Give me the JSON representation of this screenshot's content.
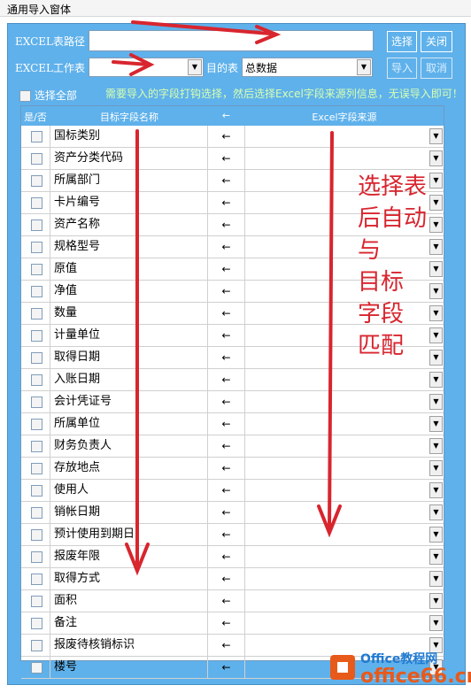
{
  "window": {
    "title": "通用导入窗体"
  },
  "form": {
    "path_label": "EXCEL表路径",
    "path_value": "",
    "sheet_label": "EXCEL工作表",
    "sheet_value": "",
    "target_label": "目的表",
    "target_value": "总数据",
    "select_btn": "选择",
    "close_btn": "关闭",
    "import_btn": "导入",
    "cancel_btn": "取消"
  },
  "select_all_label": "选择全部",
  "hint": "需要导入的字段打钩选择，然后选择Excel字段来源列信息，无误导入即可！",
  "table": {
    "headers": [
      "是/否",
      "目标字段名称",
      "←",
      "Excel字段来源"
    ],
    "rows": [
      {
        "field": "国标类别",
        "arrow": "←"
      },
      {
        "field": "资产分类代码",
        "arrow": "←"
      },
      {
        "field": "所属部门",
        "arrow": "←"
      },
      {
        "field": "卡片编号",
        "arrow": "←"
      },
      {
        "field": "资产名称",
        "arrow": "←"
      },
      {
        "field": "规格型号",
        "arrow": "←"
      },
      {
        "field": "原值",
        "arrow": "←"
      },
      {
        "field": "净值",
        "arrow": "←"
      },
      {
        "field": "数量",
        "arrow": "←"
      },
      {
        "field": "计量单位",
        "arrow": "←"
      },
      {
        "field": "取得日期",
        "arrow": "←"
      },
      {
        "field": "入账日期",
        "arrow": "←"
      },
      {
        "field": "会计凭证号",
        "arrow": "←"
      },
      {
        "field": "所属单位",
        "arrow": "←"
      },
      {
        "field": "财务负责人",
        "arrow": "←"
      },
      {
        "field": "存放地点",
        "arrow": "←"
      },
      {
        "field": "使用人",
        "arrow": "←"
      },
      {
        "field": "销帐日期",
        "arrow": "←"
      },
      {
        "field": "预计使用到期日",
        "arrow": "←"
      },
      {
        "field": "报废年限",
        "arrow": "←"
      },
      {
        "field": "取得方式",
        "arrow": "←"
      },
      {
        "field": "面积",
        "arrow": "←"
      },
      {
        "field": "备注",
        "arrow": "←"
      },
      {
        "field": "报废待核销标识",
        "arrow": "←"
      },
      {
        "field": "楼号",
        "arrow": "←"
      }
    ]
  },
  "annotation": "选择表\n后自动\n与\n目标\n字段\n匹配",
  "watermark": {
    "top": "Office教程网",
    "bottom": "office66.cn"
  },
  "colors": {
    "panel": "#5fb1eb",
    "annotation": "#d8252e"
  }
}
